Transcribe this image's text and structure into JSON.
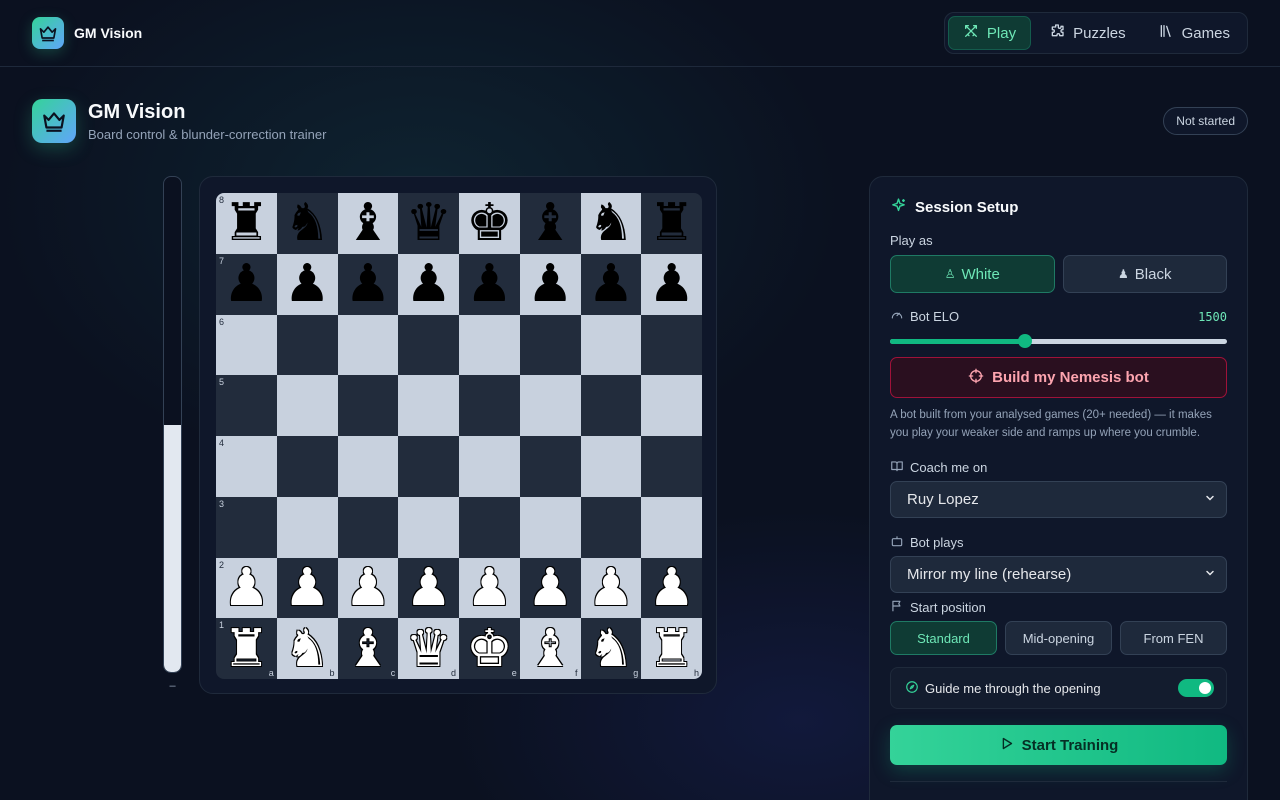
{
  "app": {
    "name": "GM Vision"
  },
  "nav": [
    {
      "label": "Play",
      "icon": "swords-icon",
      "active": true
    },
    {
      "label": "Puzzles",
      "icon": "puzzle-icon",
      "active": false
    },
    {
      "label": "Games",
      "icon": "library-icon",
      "active": false
    }
  ],
  "header": {
    "title": "GM Vision",
    "subtitle": "Board control & blunder-correction trainer",
    "status": "Not started"
  },
  "eval": {
    "white_fraction": 0.5,
    "label": "–"
  },
  "board": {
    "ranks": [
      "8",
      "7",
      "6",
      "5",
      "4",
      "3",
      "2",
      "1"
    ],
    "files": [
      "a",
      "b",
      "c",
      "d",
      "e",
      "f",
      "g",
      "h"
    ],
    "position": [
      [
        "r",
        "n",
        "b",
        "q",
        "k",
        "b",
        "n",
        "r"
      ],
      [
        "p",
        "p",
        "p",
        "p",
        "p",
        "p",
        "p",
        "p"
      ],
      [
        "",
        "",
        "",
        "",
        "",
        "",
        "",
        ""
      ],
      [
        "",
        "",
        "",
        "",
        "",
        "",
        "",
        ""
      ],
      [
        "",
        "",
        "",
        "",
        "",
        "",
        "",
        ""
      ],
      [
        "",
        "",
        "",
        "",
        "",
        "",
        "",
        ""
      ],
      [
        "P",
        "P",
        "P",
        "P",
        "P",
        "P",
        "P",
        "P"
      ],
      [
        "R",
        "N",
        "B",
        "Q",
        "K",
        "B",
        "N",
        "R"
      ]
    ]
  },
  "setup": {
    "title": "Session Setup",
    "play_as_label": "Play as",
    "white_label": "White",
    "black_label": "Black",
    "selected_side": "white",
    "elo_label": "Bot ELO",
    "elo_value": "1500",
    "elo_fraction": 0.4,
    "nemesis_label": "Build my Nemesis bot",
    "nemesis_hint": "A bot built from your analysed games (20+ needed) — it makes you play your weaker side and ramps up where you crumble.",
    "coach_label": "Coach me on",
    "coach_value": "Ruy Lopez",
    "bot_plays_label": "Bot plays",
    "bot_plays_value": "Mirror my line (rehearse)",
    "start_position_label": "Start position",
    "start_options": [
      "Standard",
      "Mid-opening",
      "From FEN"
    ],
    "start_selected": 0,
    "guide_label": "Guide me through the opening",
    "guide_on": true,
    "start_button": "Start Training"
  },
  "colors": {
    "accent": "#10b981",
    "danger": "#f43f5e",
    "light_square": "#c8d1de",
    "dark_square": "#222c3c"
  }
}
